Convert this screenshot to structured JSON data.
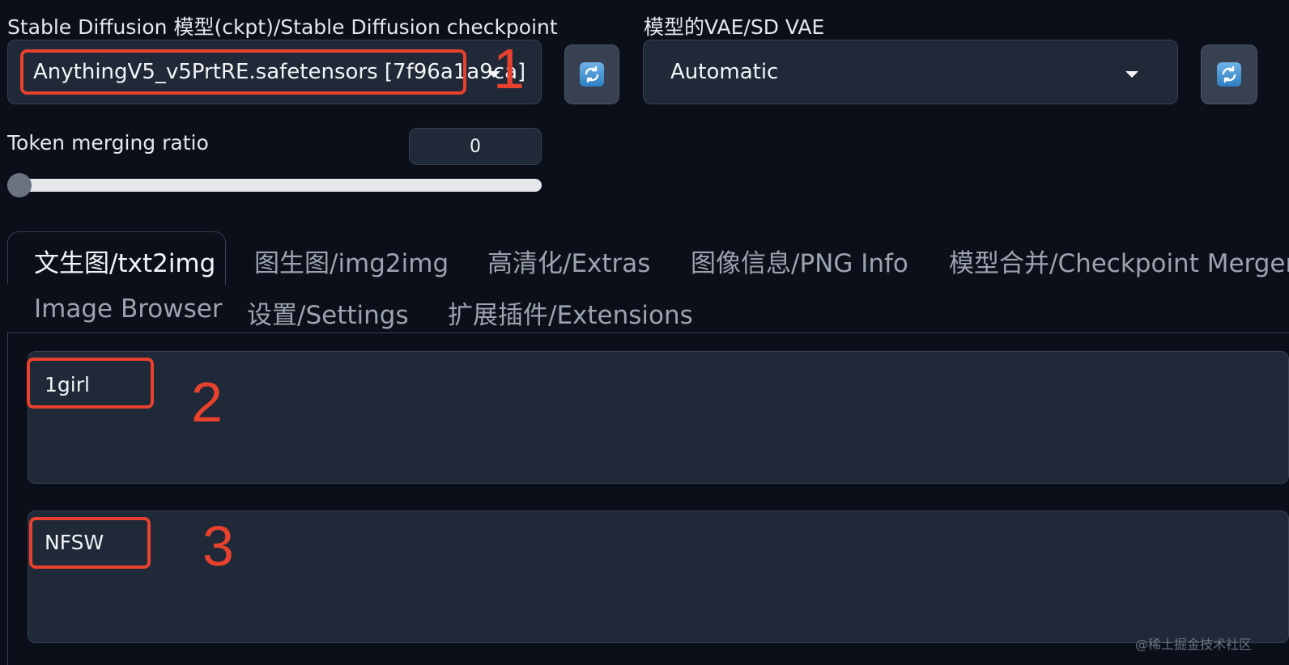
{
  "checkpoint": {
    "label": "Stable Diffusion 模型(ckpt)/Stable Diffusion checkpoint",
    "value": "AnythingV5_v5PrtRE.safetensors [7f96a1a9ca]"
  },
  "vae": {
    "label": "模型的VAE/SD VAE",
    "value": "Automatic"
  },
  "token_merging": {
    "label": "Token merging ratio",
    "value": "0",
    "slider_fraction": 0
  },
  "tabs_row1": [
    {
      "label": "文生图/txt2img",
      "active": true
    },
    {
      "label": "图生图/img2img",
      "active": false
    },
    {
      "label": "高清化/Extras",
      "active": false
    },
    {
      "label": "图像信息/PNG Info",
      "active": false
    },
    {
      "label": "模型合并/Checkpoint Merger",
      "active": false
    }
  ],
  "tabs_row2": [
    {
      "label": "Image Browser"
    },
    {
      "label": "设置/Settings"
    },
    {
      "label": "扩展插件/Extensions"
    }
  ],
  "prompt": {
    "value": "1girl"
  },
  "negative_prompt": {
    "value": "NFSW"
  },
  "annotations": [
    "1",
    "2",
    "3"
  ],
  "watermark": "@稀土掘金技术社区",
  "colors": {
    "background": "#0b0f19",
    "input_bg": "#1f2937",
    "border": "#374151",
    "annotation_red": "#e8412e"
  }
}
